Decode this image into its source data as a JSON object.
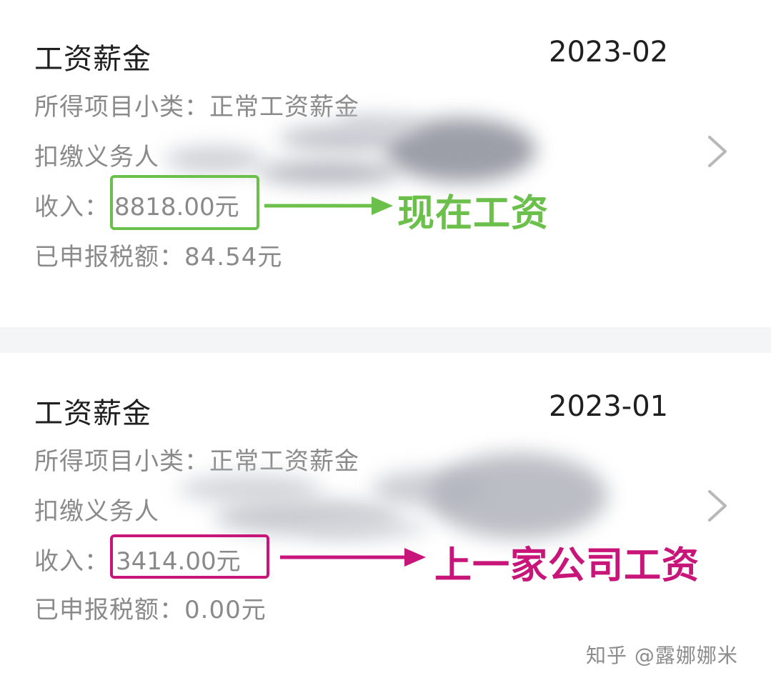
{
  "records": [
    {
      "title": "工资薪金",
      "date": "2023-02",
      "category_label": "所得项目小类：",
      "category_value": "正常工资薪金",
      "payer_label": "扣缴义务人",
      "income_label": "收入：",
      "income_value": "8818.00元",
      "tax_label": "已申报税额：",
      "tax_value": "84.54元",
      "annotation": "现在工资",
      "annotation_color": "#6bc04b"
    },
    {
      "title": "工资薪金",
      "date": "2023-01",
      "category_label": "所得项目小类：",
      "category_value": "正常工资薪金",
      "payer_label": "扣缴义务人",
      "income_label": "收入：",
      "income_value": "3414.00元",
      "tax_label": "已申报税额：",
      "tax_value": "0.00元",
      "annotation": "上一家公司工资",
      "annotation_color": "#c8157a"
    }
  ],
  "watermark": "知乎 @露娜娜米",
  "icons": {
    "chevron": "chevron-right-icon"
  }
}
